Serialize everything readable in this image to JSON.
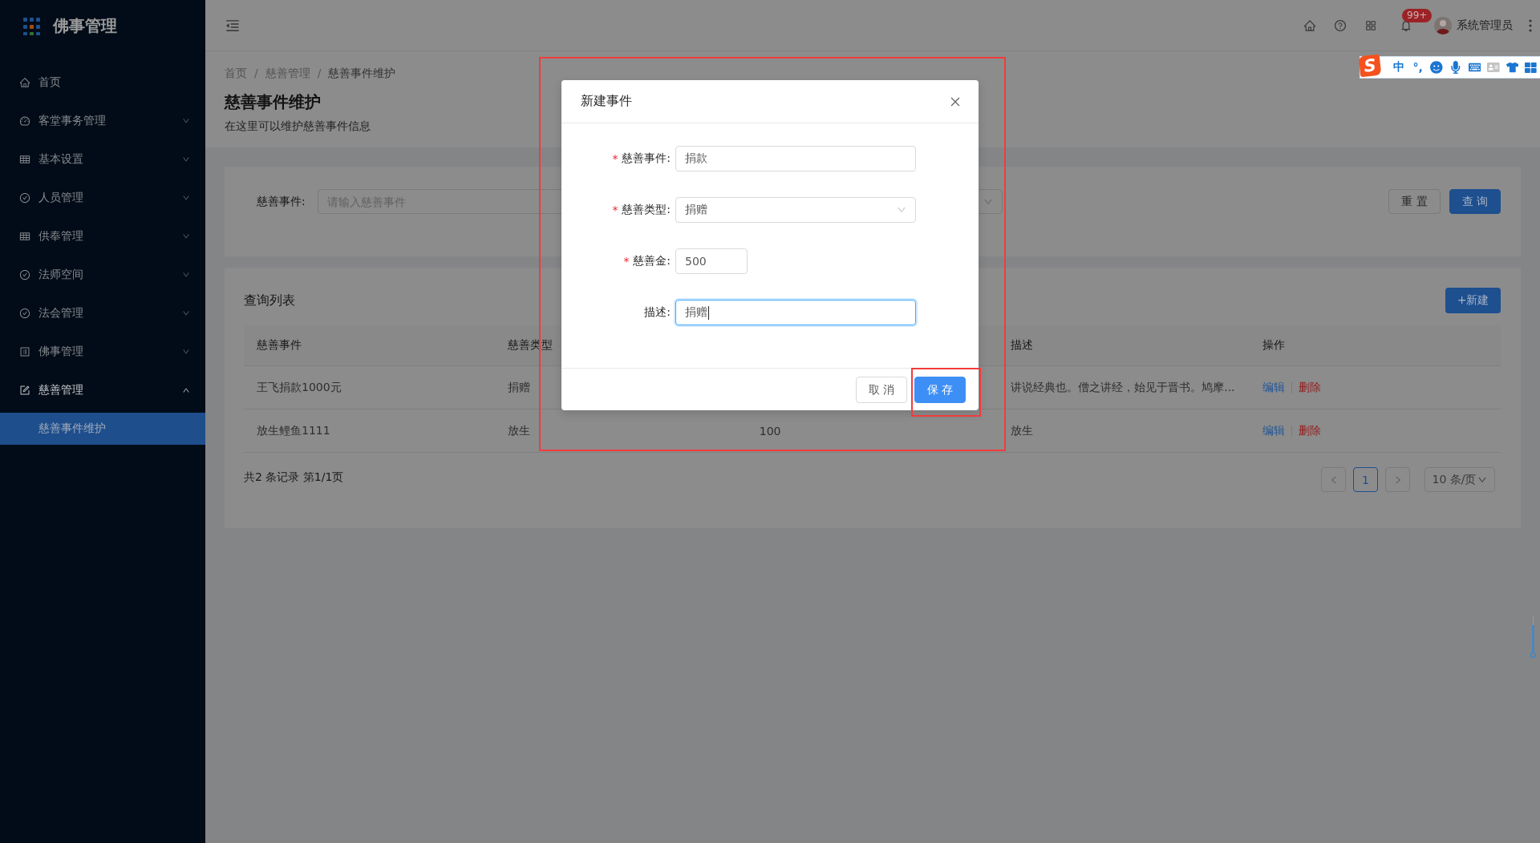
{
  "sidebar": {
    "logo": "佛事管理",
    "items": [
      {
        "label": "首页",
        "selected": false
      },
      {
        "label": "客堂事务管理",
        "selected": false,
        "expanded": false
      },
      {
        "label": "基本设置",
        "selected": false,
        "expanded": false
      },
      {
        "label": "人员管理",
        "selected": false,
        "expanded": false
      },
      {
        "label": "供奉管理",
        "selected": false,
        "expanded": false
      },
      {
        "label": "法师空间",
        "selected": false,
        "expanded": false
      },
      {
        "label": "法会管理",
        "selected": false,
        "expanded": false
      },
      {
        "label": "佛事管理",
        "selected": false,
        "expanded": false
      },
      {
        "label": "慈善管理",
        "selected": true,
        "expanded": true,
        "children": [
          {
            "label": "慈善事件维护",
            "selected": true
          }
        ]
      }
    ]
  },
  "header": {
    "notification_badge": "99+",
    "user": "系统管理员"
  },
  "ime_toolbar": {
    "logo": "S",
    "mode": "中",
    "punctuation": "°,"
  },
  "breadcrumb": {
    "items": [
      "首页",
      "慈善管理",
      "慈善事件维护"
    ],
    "separator": "/"
  },
  "page_header": {
    "title": "慈善事件维护",
    "subtitle": "在这里可以维护慈善事件信息"
  },
  "search": {
    "fields": [
      {
        "kind": "input",
        "label": "慈善事件:",
        "placeholder": "请输入慈善事件"
      },
      {
        "kind": "select"
      }
    ],
    "buttons": [
      {
        "label": "重 置",
        "kind": "default"
      },
      {
        "label": "查 询",
        "kind": "primary"
      }
    ]
  },
  "table": {
    "title": "查询列表",
    "new_button": "+新建",
    "columns": [
      "慈善事件",
      "慈善类型",
      null,
      "描述",
      "操作"
    ],
    "rows": [
      {
        "cells": [
          "王飞捐款1000元",
          "捐赠",
          null,
          "讲说经典也。僧之讲经，始见于晋书。鸠摩..."
        ],
        "actions": [
          {
            "label": "编辑",
            "kind": "edit"
          },
          {
            "label": "删除",
            "kind": "delete"
          }
        ]
      },
      {
        "cells": [
          "放生鲤鱼1111",
          "放生",
          "100",
          "放生"
        ],
        "actions": [
          {
            "label": "编辑",
            "kind": "edit"
          },
          {
            "label": "删除",
            "kind": "delete"
          }
        ]
      }
    ]
  },
  "pagination": {
    "summary": "共2 条记录 第1/1页",
    "pages": [
      {
        "label": "1",
        "selected": true
      }
    ],
    "page_size": "10 条/页"
  },
  "dialog": {
    "title": "新建事件",
    "highlighted": true,
    "required_mark": "*",
    "fields": [
      {
        "kind": "input",
        "label": "慈善事件:",
        "required": true,
        "value": "捐款",
        "focused": false
      },
      {
        "kind": "select",
        "label": "慈善类型:",
        "required": true,
        "value": "捐赠",
        "focused": false
      },
      {
        "kind": "number",
        "label": "慈善金:",
        "required": true,
        "value": "500",
        "focused": false
      },
      {
        "kind": "input",
        "label": "描述:",
        "required": false,
        "value": "捐赠",
        "focused": true
      }
    ],
    "buttons": [
      {
        "label": "取 消",
        "kind": "default",
        "highlighted": false
      },
      {
        "label": "保 存",
        "kind": "primary",
        "highlighted": true
      }
    ]
  }
}
